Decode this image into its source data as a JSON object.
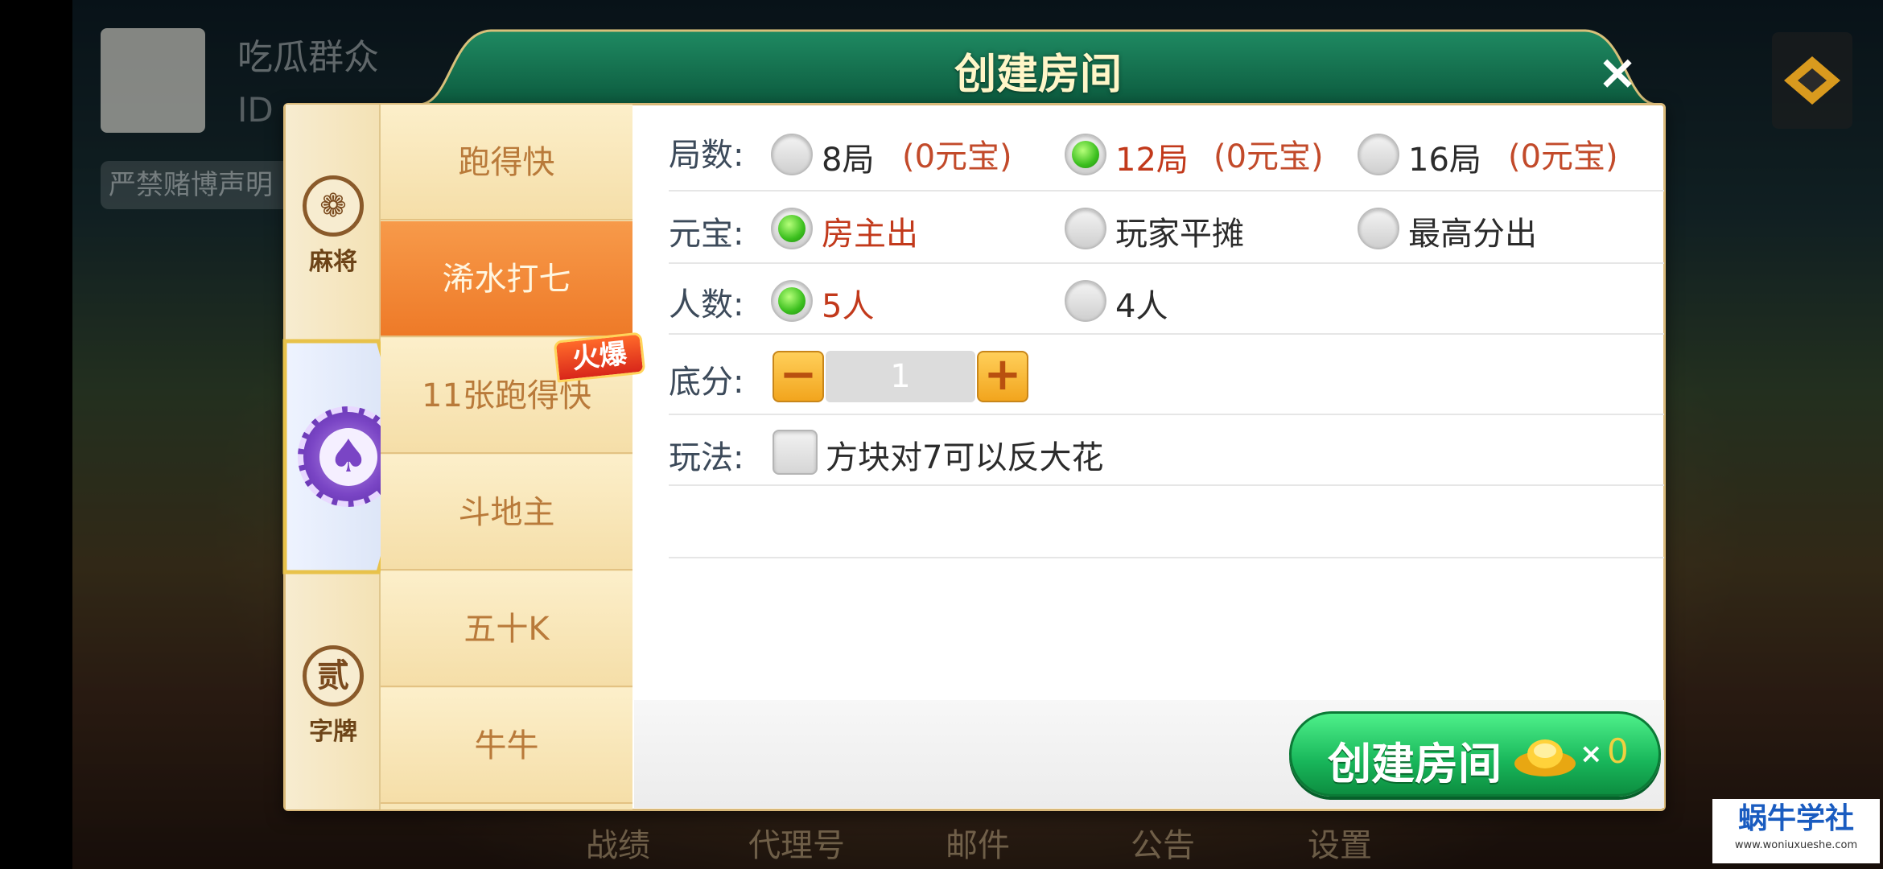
{
  "background": {
    "name": "吃瓜群众",
    "id_prefix": "ID",
    "warning": "严禁赌博声明",
    "bottom_nav": [
      "战绩",
      "代理号",
      "邮件",
      "公告",
      "设置"
    ]
  },
  "dialog": {
    "title": "创建房间",
    "close": "×"
  },
  "categories": [
    {
      "icon_glyph": "❁",
      "label": "麻将"
    },
    {
      "icon_glyph": "♠",
      "label": ""
    },
    {
      "icon_glyph": "贰",
      "label": "字牌"
    }
  ],
  "games": [
    "跑得快",
    "浠水打七",
    "11张跑得快",
    "斗地主",
    "五十K",
    "牛牛"
  ],
  "hot_badge": "火爆",
  "options": {
    "rounds": {
      "label": "局数:",
      "choices": [
        {
          "text": "8局",
          "cost": "(0元宝)",
          "selected": false
        },
        {
          "text": "12局",
          "cost": "(0元宝)",
          "selected": true
        },
        {
          "text": "16局",
          "cost": "(0元宝)",
          "selected": false
        }
      ]
    },
    "ingot": {
      "label": "元宝:",
      "choices": [
        {
          "text": "房主出",
          "selected": true
        },
        {
          "text": "玩家平摊",
          "selected": false
        },
        {
          "text": "最高分出",
          "selected": false
        }
      ]
    },
    "players": {
      "label": "人数:",
      "choices": [
        {
          "text": "5人",
          "selected": true
        },
        {
          "text": "4人",
          "selected": false
        }
      ]
    },
    "base_score": {
      "label": "底分:",
      "minus": "−",
      "value": "1",
      "plus": "+"
    },
    "rules": {
      "label": "玩法:",
      "checkbox_text": "方块对7可以反大花",
      "checked": false
    }
  },
  "create_button": {
    "label": "创建房间",
    "times": "×",
    "count": "0"
  },
  "watermark": {
    "title": "蜗牛学社",
    "url": "www.woniuxueshe.com"
  }
}
